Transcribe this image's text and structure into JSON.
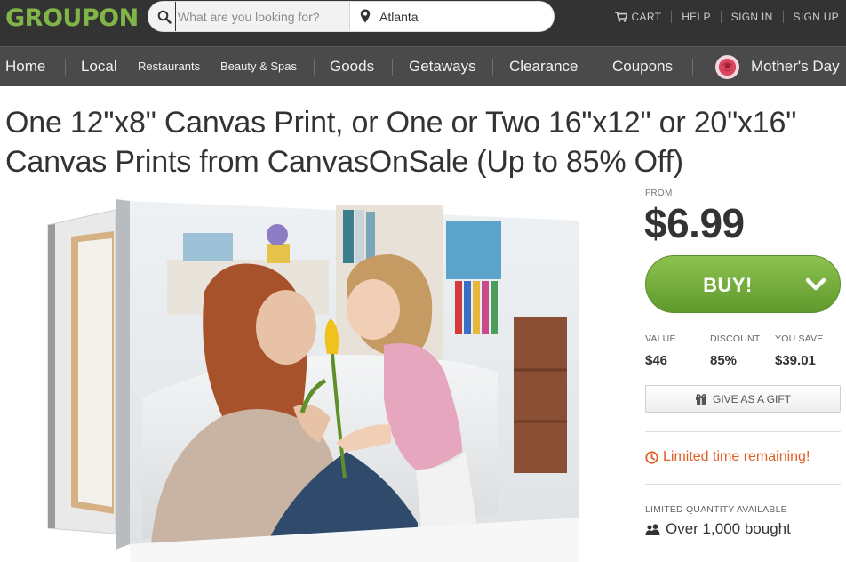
{
  "header": {
    "logo": "GROUPON",
    "search": {
      "placeholder": "What are you looking for?",
      "value": ""
    },
    "location": "Atlanta",
    "links": {
      "cart": "CART",
      "help": "HELP",
      "sign_in": "SIGN IN",
      "sign_up": "SIGN UP"
    }
  },
  "nav": {
    "items": [
      "Home",
      "Local",
      "Restaurants",
      "Beauty & Spas",
      "Goods",
      "Getaways",
      "Clearance",
      "Coupons",
      "Mother's Day"
    ]
  },
  "deal": {
    "title_line1": "One 12\"x8\" Canvas Print, or One or Two 16\"x12\" or 20\"x16\"",
    "title_line2": "Canvas Prints from CanvasOnSale (Up to 85% Off)",
    "from_label": "FROM",
    "price": "$6.99",
    "buy_label": "BUY!",
    "stats": {
      "value_label": "VALUE",
      "value": "$46",
      "discount_label": "DISCOUNT",
      "discount": "85%",
      "save_label": "YOU SAVE",
      "save": "$39.01"
    },
    "gift_label": "GIVE AS A GIFT",
    "limited_time": "Limited time remaining!",
    "limited_quantity": "LIMITED QUANTITY AVAILABLE",
    "bought": "Over 1,000 bought"
  },
  "colors": {
    "brand_green": "#82b548",
    "buy_green": "#6aa733",
    "topbar": "#333333",
    "nav": "#4a4a4a",
    "urgent": "#e35e24"
  },
  "icons": [
    "search-icon",
    "location-pin-icon",
    "cart-icon",
    "rose-icon",
    "chevron-down-icon",
    "gift-icon",
    "clock-icon",
    "people-icon"
  ]
}
